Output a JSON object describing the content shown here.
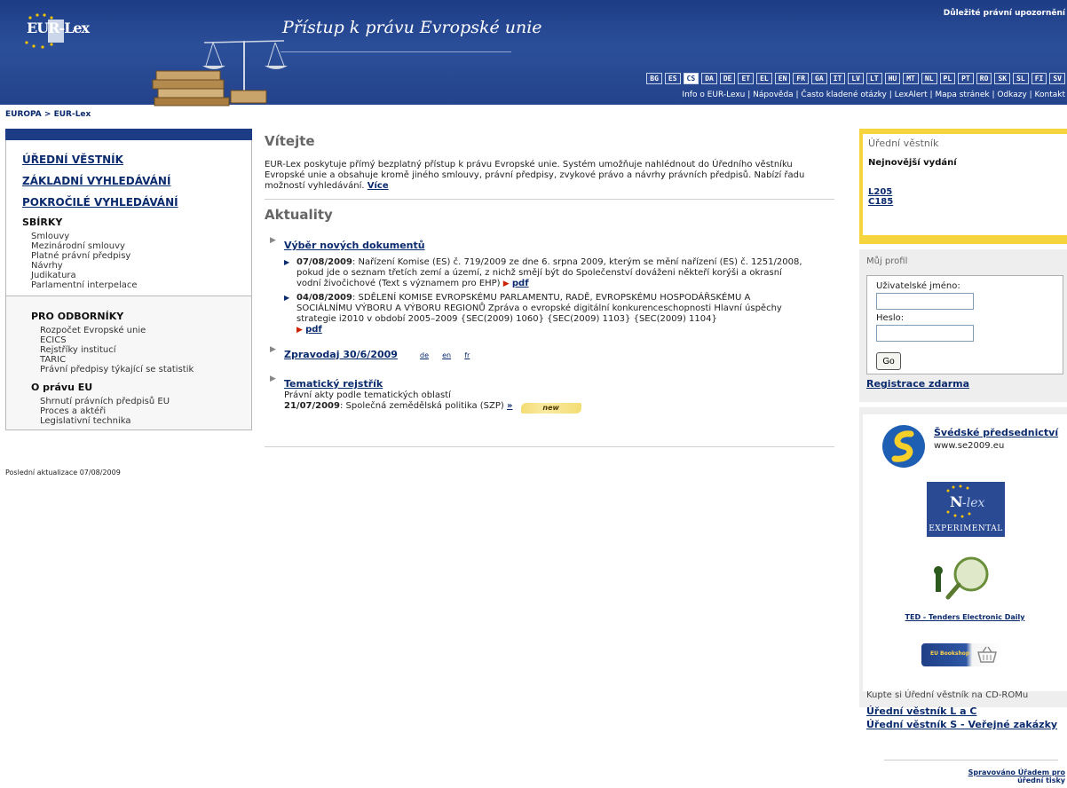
{
  "header": {
    "logo_text": "EUR-Lex",
    "title": "Přístup k právu Evropské unie",
    "legal_notice": "Důležité právní upozornění",
    "languages": [
      "BG",
      "ES",
      "CS",
      "DA",
      "DE",
      "ET",
      "EL",
      "EN",
      "FR",
      "GA",
      "IT",
      "LV",
      "LT",
      "HU",
      "MT",
      "NL",
      "PL",
      "PT",
      "RO",
      "SK",
      "SL",
      "FI",
      "SV"
    ],
    "active_language": "CS",
    "top_links": "Info o EUR-Lexu | Nápověda | Často kladené otázky | LexAlert | Mapa stránek | Odkazy | Kontakt"
  },
  "breadcrumb": "EUROPA > EUR-Lex",
  "sidebar": {
    "main_links": [
      "ÚŘEDNÍ VĚSTNÍK",
      "ZÁKLADNÍ VYHLEDÁVÁNÍ",
      "POKROČILÉ VYHLEDÁVÁNÍ"
    ],
    "collections_heading": "SBÍRKY",
    "collections": [
      "Smlouvy",
      "Mezinárodní smlouvy",
      "Platné právní předpisy",
      "Návrhy",
      "Judikatura",
      "Parlamentní interpelace"
    ],
    "experts_heading": "PRO ODBORNÍKY",
    "experts": [
      "Rozpočet Evropské unie",
      "ECICS",
      "Rejstříky institucí",
      "TARIC",
      "Právní předpisy týkající se statistik"
    ],
    "about_heading": "O právu EU",
    "about": [
      "Shrnutí právních předpisů EU",
      "Proces a aktéři",
      "Legislativní technika"
    ],
    "last_update": "Poslední aktualizace 07/08/2009"
  },
  "main": {
    "welcome_heading": "Vítejte",
    "welcome_text": "EUR-Lex poskytuje přímý bezplatný přístup k právu Evropské unie. Systém umožňuje nahlédnout do Úředního věstníku Evropské unie a obsahuje kromě jiného smlouvy, právní předpisy, zvykové právo a návrhy právních předpisů. Nabízí řadu možností vyhledávání.",
    "welcome_more": "Více",
    "news_heading": "Aktuality",
    "selection_title": "Výběr nových dokumentů",
    "news_items": [
      {
        "date": "07/08/2009",
        "text": ": Nařízení Komise (ES) č. 719/2009 ze dne 6. srpna 2009, kterým se mění nařízení (ES) č. 1251/2008, pokud jde o seznam třetích zemí a území, z nichž smějí být do Společenství dováženi někteří korýši a okrasní vodní živočichové (Text s významem pro EHP)",
        "pdf": "pdf"
      },
      {
        "date": "04/08/2009",
        "text": ": SDĚLENÍ KOMISE EVROPSKÉMU PARLAMENTU, RADĚ, EVROPSKÉMU HOSPODÁŘSKÉMU A SOCIÁLNÍMU VÝBORU A VÝBORU REGIONŮ Zpráva o evropské digitální konkurenceschopnosti Hlavní úspěchy strategie i2010 v období 2005–2009 {SEC(2009) 1060} {SEC(2009) 1103} {SEC(2009) 1104}",
        "pdf": "pdf"
      }
    ],
    "newsletter_title": "Zpravodaj 30/6/2009",
    "newsletter_langs": [
      "de",
      "en",
      "fr"
    ],
    "thematic_title": "Tematický rejstřík",
    "thematic_desc": "Právní akty podle tematických oblastí",
    "thematic_date": "21/07/2009",
    "thematic_text": ": Společná zemědělská politika (SZP)",
    "thematic_more": "»",
    "new_badge": "new"
  },
  "right": {
    "oj_title": "Úřední věstník",
    "oj_latest": "Nejnovější vydání",
    "oj_issues": [
      "L205",
      "C185"
    ],
    "profile_title": "Můj profil",
    "username_label": "Uživatelské jméno:",
    "password_label": "Heslo:",
    "go_button": "Go",
    "register": "Registrace zdarma",
    "presidency_link": "Švédské předsednictví",
    "presidency_url": "www.se2009.eu",
    "nlex_text": "EXPERIMENTAL",
    "ted_link": "TED - Tenders Electronic Daily",
    "bookshop_text": "EU Bookshop",
    "cd_title": "Kupte si Úřední věstník na CD-ROMu",
    "cd_links": [
      "Úřední věstník L a C",
      "Úřední věstník S - Veřejné zakázky"
    ],
    "managed_line1": "Spravováno Úřadem pro",
    "managed_line2": "úřední tisky"
  },
  "colors": {
    "header_blue": "#1d3c86",
    "link_blue": "#0a2a6e",
    "oj_yellow": "#f5d43e"
  }
}
